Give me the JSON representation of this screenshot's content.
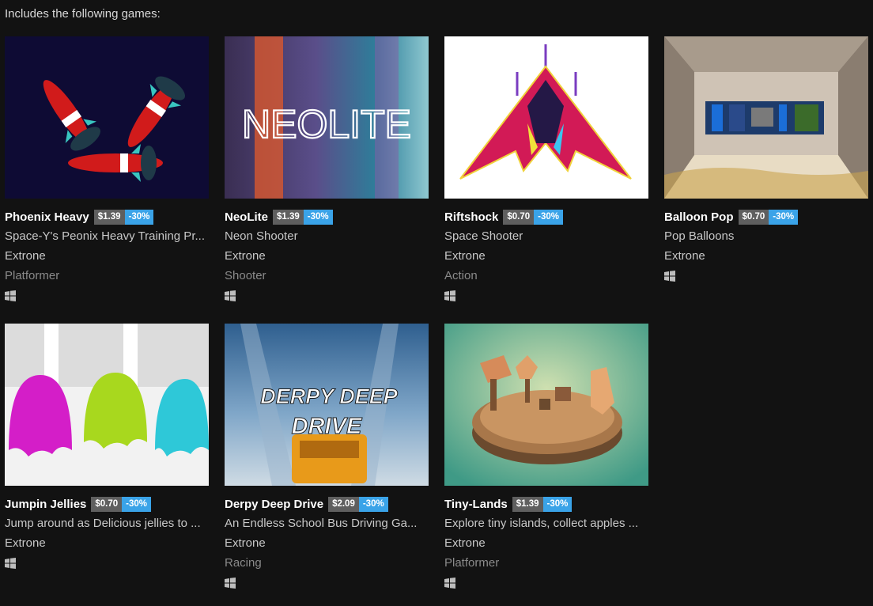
{
  "header": {
    "text": "Includes the following games:"
  },
  "games": [
    {
      "title": "Phoenix Heavy",
      "price": "$1.39",
      "discount": "-30%",
      "desc": "Space-Y's Peonix Heavy Training Pr...",
      "author": "Extrone",
      "genre": "Platformer",
      "platform_icon": "windows-icon"
    },
    {
      "title": "NeoLite",
      "price": "$1.39",
      "discount": "-30%",
      "desc": "Neon Shooter",
      "author": "Extrone",
      "genre": "Shooter",
      "platform_icon": "windows-icon",
      "thumb_text": "NEOLITE"
    },
    {
      "title": "Riftshock",
      "price": "$0.70",
      "discount": "-30%",
      "desc": "Space Shooter",
      "author": "Extrone",
      "genre": "Action",
      "platform_icon": "windows-icon"
    },
    {
      "title": "Balloon Pop",
      "price": "$0.70",
      "discount": "-30%",
      "desc": "Pop Balloons",
      "author": "Extrone",
      "genre": "",
      "platform_icon": "windows-icon"
    },
    {
      "title": "Jumpin Jellies",
      "price": "$0.70",
      "discount": "-30%",
      "desc": "Jump around as Delicious jellies to ...",
      "author": "Extrone",
      "genre": "",
      "platform_icon": "windows-icon"
    },
    {
      "title": "Derpy Deep Drive",
      "price": "$2.09",
      "discount": "-30%",
      "desc": "An Endless School Bus Driving Ga...",
      "author": "Extrone",
      "genre": "Racing",
      "platform_icon": "windows-icon",
      "thumb_text_1": "DERPY DEEP",
      "thumb_text_2": "DRIVE"
    },
    {
      "title": "Tiny-Lands",
      "price": "$1.39",
      "discount": "-30%",
      "desc": "Explore tiny islands, collect apples ...",
      "author": "Extrone",
      "genre": "Platformer",
      "platform_icon": "windows-icon"
    }
  ],
  "colors": {
    "background": "#121212",
    "price_bg": "#5f5f5f",
    "discount_bg": "#3aa3e8"
  }
}
